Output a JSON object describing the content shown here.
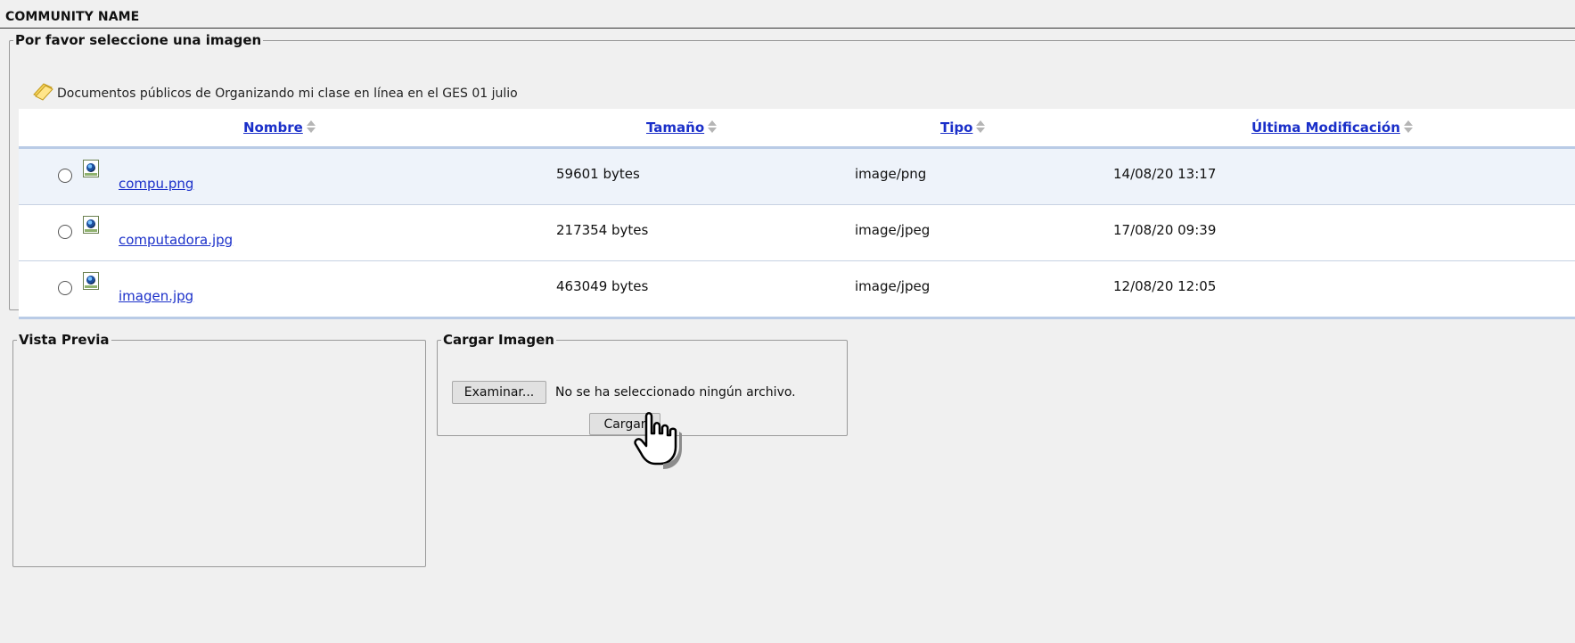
{
  "community": {
    "name": "COMMUNITY NAME"
  },
  "image_select": {
    "legend": "Por favor seleccione una imagen",
    "folder_text": "Documentos públicos de Organizando mi clase en línea en el GES 01 julio",
    "columns": [
      {
        "label": "Nombre"
      },
      {
        "label": "Tamaño"
      },
      {
        "label": "Tipo"
      },
      {
        "label": "Última Modificación"
      }
    ],
    "files": [
      {
        "name": "compu.png",
        "size": "59601 bytes",
        "type": "image/png",
        "modified": "14/08/20 13:17"
      },
      {
        "name": "computadora.jpg",
        "size": "217354 bytes",
        "type": "image/jpeg",
        "modified": "17/08/20 09:39"
      },
      {
        "name": "imagen.jpg",
        "size": "463049 bytes",
        "type": "image/jpeg",
        "modified": "12/08/20 12:05"
      }
    ]
  },
  "preview": {
    "legend": "Vista Previa"
  },
  "upload": {
    "legend": "Cargar Imagen",
    "browse_label": "Examinar...",
    "no_file_text": "No se ha seleccionado ningún archivo.",
    "submit_label": "Cargar"
  },
  "icons": {
    "folder": "folder-icon",
    "file": "image-file-icon",
    "sort": "sort-arrows-icon",
    "cursor": "hand-cursor-icon"
  }
}
